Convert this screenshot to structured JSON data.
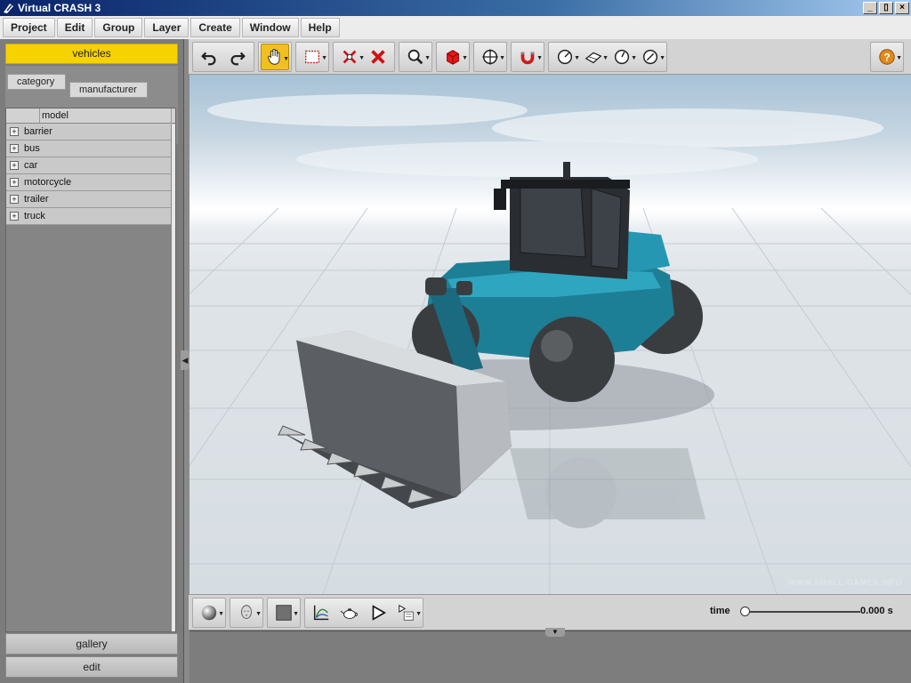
{
  "window": {
    "title": "Virtual CRASH 3",
    "controls": [
      "_",
      "▯",
      "×"
    ]
  },
  "menu": [
    "Project",
    "Edit",
    "Group",
    "Layer",
    "Create",
    "Window",
    "Help"
  ],
  "left_panel": {
    "active_tab": "vehicles",
    "filter_tabs": [
      "category",
      "manufacturer"
    ],
    "list_header": "model",
    "items": [
      "barrier",
      "bus",
      "car",
      "motorcycle",
      "trailer",
      "truck"
    ],
    "bottom_buttons": [
      "gallery",
      "edit"
    ]
  },
  "toolbar": {
    "groups": [
      [
        "undo-icon",
        "redo-icon"
      ],
      [
        "hand-pan-icon"
      ],
      [
        "select-rect-icon"
      ],
      [
        "delete-point-icon"
      ],
      [
        "delete-icon"
      ],
      [
        "zoom-icon"
      ],
      [
        "cube-icon"
      ],
      [
        "move-icon"
      ],
      [
        "magnet-icon"
      ],
      [
        "measure-angle-icon",
        "plane-icon",
        "gauge-icon",
        "speedometer-icon"
      ],
      [
        "help-icon"
      ]
    ],
    "active_tool": "hand-pan-icon",
    "accent_color": "#f0c020"
  },
  "bottom_toolbar": {
    "buttons": [
      "sphere-render-icon",
      "head-icon",
      "color-square-icon",
      "graph-icon",
      "teapot-icon",
      "play-icon",
      "playlist-icon"
    ],
    "time_label": "time",
    "time_value": "0.000 s",
    "time_position": 0
  },
  "watermark": "WWW.SMALL-GAMES.INFO"
}
